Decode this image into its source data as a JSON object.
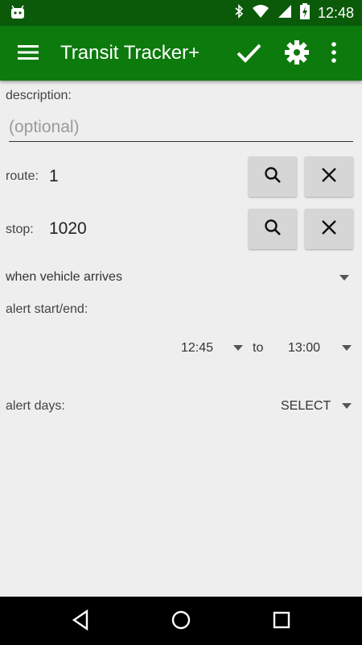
{
  "status_bar": {
    "time": "12:48",
    "icons": [
      "android-icon",
      "bluetooth-icon",
      "wifi-icon",
      "battery-charging-icon"
    ]
  },
  "app_bar": {
    "title": "Transit Tracker+",
    "actions": [
      "menu-icon",
      "check-icon",
      "gear-icon",
      "more-vert-icon"
    ],
    "color": "#0d7a0d"
  },
  "form": {
    "description_label": "description:",
    "description_placeholder": "(optional)",
    "description_value": "",
    "route_label": "route:",
    "route_value": "1",
    "stop_label": "stop:",
    "stop_value": "1020",
    "trigger_selected": "when vehicle arrives",
    "alert_start_end_label": "alert start/end:",
    "start_time": "12:45",
    "to_label": "to",
    "end_time": "13:00",
    "alert_days_label": "alert days:",
    "alert_days_value": "SELECT"
  },
  "nav_bar": {
    "buttons": [
      "back-icon",
      "home-icon",
      "recents-icon"
    ]
  }
}
